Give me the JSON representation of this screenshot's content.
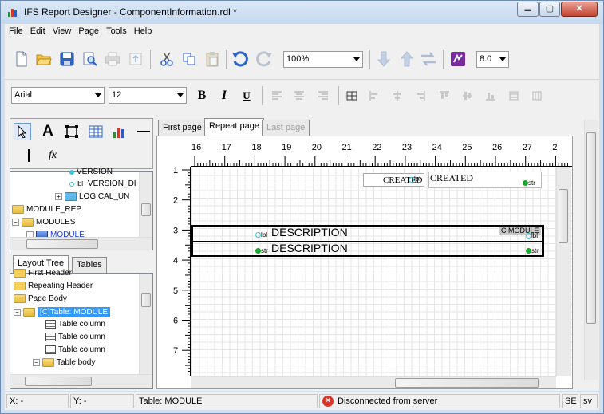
{
  "window": {
    "title": "IFS Report Designer - ComponentInformation.rdl *",
    "minimize_glyph": "▬",
    "maximize_glyph": "▢",
    "close_glyph": "✕"
  },
  "menu": [
    "File",
    "Edit",
    "View",
    "Page",
    "Tools",
    "Help"
  ],
  "toolbar": {
    "zoom": "100%",
    "version": "8.0",
    "font_name": "Arial",
    "font_size": "12",
    "bold": "B",
    "italic": "I",
    "underline": "U",
    "icons": [
      "new-file-icon",
      "open-folder-icon",
      "save-icon",
      "print-preview-icon",
      "print-icon",
      "export-icon",
      "cut-icon",
      "copy-icon",
      "paste-icon",
      "undo-icon",
      "redo-icon",
      "move-down-icon",
      "move-up-icon",
      "swap-icon",
      "ifs-logo-icon"
    ]
  },
  "toolbox": {
    "fx_label": "fx",
    "text_tool": "A"
  },
  "data_tree": {
    "items": [
      {
        "label": "VERSION"
      },
      {
        "label": "VERSION_DI"
      },
      {
        "label": "LOGICAL_UN"
      },
      {
        "label": "MODULE_REP"
      },
      {
        "label": "MODULES"
      },
      {
        "label": "MODULE"
      }
    ],
    "lbl_tag": "lbl"
  },
  "left_tabs": {
    "layout_tree": "Layout Tree",
    "tables": "Tables"
  },
  "layout_tree": {
    "items": [
      {
        "label": "First Header"
      },
      {
        "label": "Repeating Header"
      },
      {
        "label": "Page Body"
      },
      {
        "label": "[C]Table: MODULE"
      },
      {
        "label": "Table column"
      },
      {
        "label": "Table column"
      },
      {
        "label": "Table column"
      },
      {
        "label": "Table body"
      }
    ]
  },
  "page_tabs": {
    "first": "First page",
    "repeat": "Repeat page",
    "last": "Last page"
  },
  "ruler": {
    "top": [
      "16",
      "17",
      "18",
      "19",
      "20",
      "21",
      "22",
      "23",
      "24",
      "25",
      "26",
      "27",
      "2"
    ],
    "left": [
      "1",
      "2",
      "3",
      "4",
      "5",
      "6",
      "7"
    ]
  },
  "canvas_fields": {
    "created_label": "CREATED",
    "created_value": "CREATED",
    "description_label": "DESCRIPTION",
    "description_value": "DESCRIPTION",
    "module_tag": "C MODULE",
    "lbl_tag": "lbl",
    "str_tag": "str"
  },
  "statusbar": {
    "x": "X: -",
    "y": "Y: -",
    "selection": "Table: MODULE",
    "connection": "Disconnected from server",
    "se": "SE",
    "sv": "sv"
  },
  "colors": {
    "accent": "#3399ff",
    "selection": "#3399ff",
    "status_error": "#d9372b",
    "lbl_dot": "#38c5d8",
    "str_dot": "#17a52c"
  }
}
